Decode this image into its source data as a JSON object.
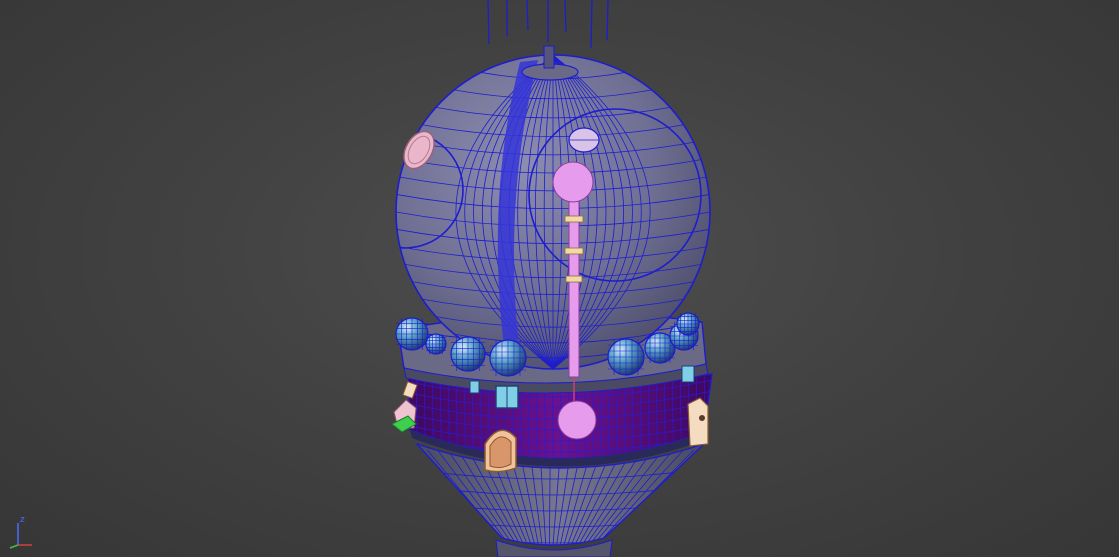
{
  "viewport": {
    "background_color": "#454545",
    "wire_color": "#1d1dcf",
    "shell_color": "#77779a",
    "band_color": "#5a0f7c",
    "highlight_color": "#e69bec"
  },
  "axis_gizmo": {
    "z_label": "z",
    "icon": "axis-tripod-icon"
  }
}
